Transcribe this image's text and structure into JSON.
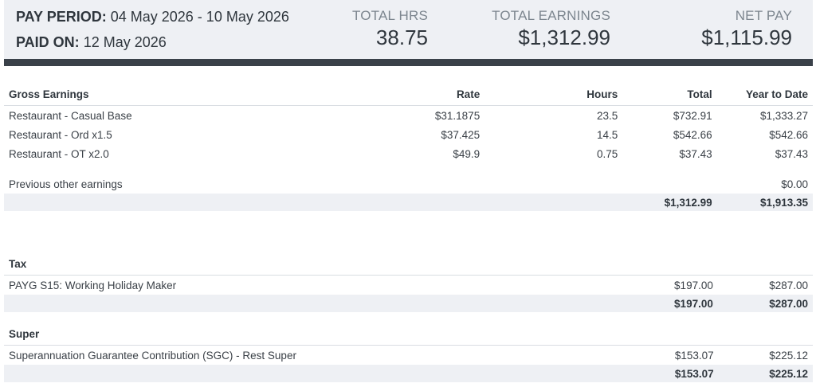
{
  "header": {
    "pay_period_label": "PAY PERIOD:",
    "pay_period_value": "04 May 2026 - 10 May 2026",
    "paid_on_label": "PAID ON:",
    "paid_on_value": "12 May 2026",
    "total_hrs_label": "TOTAL HRS",
    "total_hrs_value": "38.75",
    "total_earnings_label": "TOTAL EARNINGS",
    "total_earnings_value": "$1,312.99",
    "net_pay_label": "NET PAY",
    "net_pay_value": "$1,115.99"
  },
  "gross": {
    "heading": "Gross Earnings",
    "col_rate": "Rate",
    "col_hours": "Hours",
    "col_total": "Total",
    "col_ytd": "Year to Date",
    "rows": [
      {
        "name": "Restaurant - Casual Base",
        "rate": "$31.1875",
        "hours": "23.5",
        "total": "$732.91",
        "ytd": "$1,333.27"
      },
      {
        "name": "Restaurant - Ord x1.5",
        "rate": "$37.425",
        "hours": "14.5",
        "total": "$542.66",
        "ytd": "$542.66"
      },
      {
        "name": "Restaurant - OT x2.0",
        "rate": "$49.9",
        "hours": "0.75",
        "total": "$37.43",
        "ytd": "$37.43"
      }
    ],
    "previous_label": "Previous other earnings",
    "previous_ytd": "$0.00",
    "sum_total": "$1,312.99",
    "sum_ytd": "$1,913.35"
  },
  "tax": {
    "heading": "Tax",
    "row_name": "PAYG S15: Working Holiday Maker",
    "row_total": "$197.00",
    "row_ytd": "$287.00",
    "sum_total": "$197.00",
    "sum_ytd": "$287.00"
  },
  "super": {
    "heading": "Super",
    "row_name": "Superannuation Guarantee Contribution (SGC) - Rest Super",
    "row_total": "$153.07",
    "row_ytd": "$225.12",
    "sum_total": "$153.07",
    "sum_ytd": "$225.12"
  }
}
